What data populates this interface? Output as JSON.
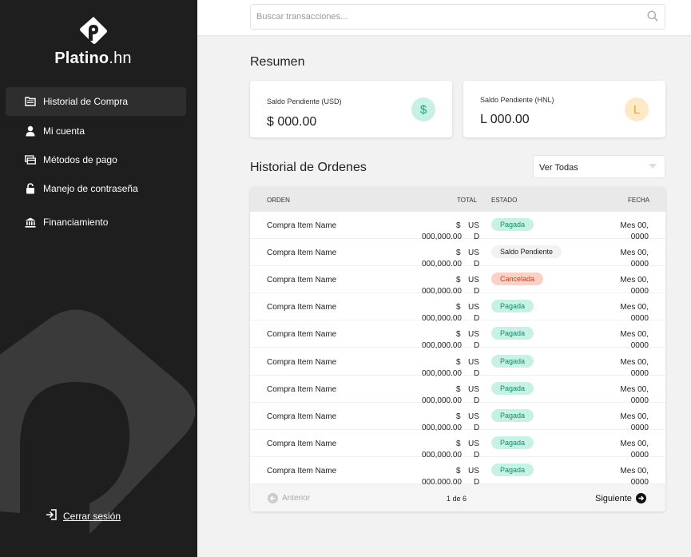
{
  "brand": {
    "bold": "Platino",
    "rest": ".hn"
  },
  "sidebar": {
    "items": [
      {
        "label": "Historial de Compra",
        "icon": "folder-icon"
      },
      {
        "label": "Mi cuenta",
        "icon": "user-icon"
      },
      {
        "label": "Métodos de pago",
        "icon": "card-icon"
      },
      {
        "label": "Manejo de contraseña",
        "icon": "lock-icon"
      },
      {
        "label": "Financiamiento",
        "icon": "bank-icon"
      }
    ],
    "logout": "Cerrar sesión"
  },
  "search": {
    "placeholder": "Buscar transacciones..."
  },
  "summary": {
    "title": "Resumen",
    "cards": [
      {
        "label": "Saldo Pendiente (USD)",
        "value": "$ 000.00",
        "symbol": "$",
        "color": "#1aa37a",
        "bg": "#c8f1e5"
      },
      {
        "label": "Saldo Pendiente (HNL)",
        "value": "L 000.00",
        "symbol": "L",
        "color": "#e5a23a",
        "bg": "#fde9c8"
      }
    ]
  },
  "orders": {
    "title": "Historial de Ordenes",
    "filter": "Ver Todas",
    "columns": {
      "order": "ORDEN",
      "total": "TOTAL",
      "status": "ESTADO",
      "date": "FECHA"
    },
    "rows": [
      {
        "name": "Compra Item Name",
        "cur": "$",
        "amount": "000,000.00",
        "us": "US",
        "d": "D",
        "status": "Pagada",
        "status_type": "pagada",
        "month": "Mes 00,",
        "year": "0000"
      },
      {
        "name": "Compra Item Name",
        "cur": "$",
        "amount": "000,000.00",
        "us": "US",
        "d": "D",
        "status": "Saldo Pendiente",
        "status_type": "pendiente",
        "month": "Mes 00,",
        "year": "0000"
      },
      {
        "name": "Compra Item Name",
        "cur": "$",
        "amount": "000,000.00",
        "us": "US",
        "d": "D",
        "status": "Cancelada",
        "status_type": "cancelada",
        "month": "Mes 00,",
        "year": "0000"
      },
      {
        "name": "Compra Item Name",
        "cur": "$",
        "amount": "000,000.00",
        "us": "US",
        "d": "D",
        "status": "Pagada",
        "status_type": "pagada",
        "month": "Mes 00,",
        "year": "0000"
      },
      {
        "name": "Compra Item Name",
        "cur": "$",
        "amount": "000,000.00",
        "us": "US",
        "d": "D",
        "status": "Pagada",
        "status_type": "pagada",
        "month": "Mes 00,",
        "year": "0000"
      },
      {
        "name": "Compra Item Name",
        "cur": "$",
        "amount": "000,000.00",
        "us": "US",
        "d": "D",
        "status": "Pagada",
        "status_type": "pagada",
        "month": "Mes 00,",
        "year": "0000"
      },
      {
        "name": "Compra Item Name",
        "cur": "$",
        "amount": "000,000.00",
        "us": "US",
        "d": "D",
        "status": "Pagada",
        "status_type": "pagada",
        "month": "Mes 00,",
        "year": "0000"
      },
      {
        "name": "Compra Item Name",
        "cur": "$",
        "amount": "000,000.00",
        "us": "US",
        "d": "D",
        "status": "Pagada",
        "status_type": "pagada",
        "month": "Mes 00,",
        "year": "0000"
      },
      {
        "name": "Compra Item Name",
        "cur": "$",
        "amount": "000,000.00",
        "us": "US",
        "d": "D",
        "status": "Pagada",
        "status_type": "pagada",
        "month": "Mes 00,",
        "year": "0000"
      },
      {
        "name": "Compra Item Name",
        "cur": "$",
        "amount": "000,000.00",
        "us": "US",
        "d": "D",
        "status": "Pagada",
        "status_type": "pagada",
        "month": "Mes 00,",
        "year": "0000"
      }
    ],
    "pagination": {
      "prev": "Anterior",
      "page": "1 de 6",
      "next": "Siguiente"
    }
  }
}
